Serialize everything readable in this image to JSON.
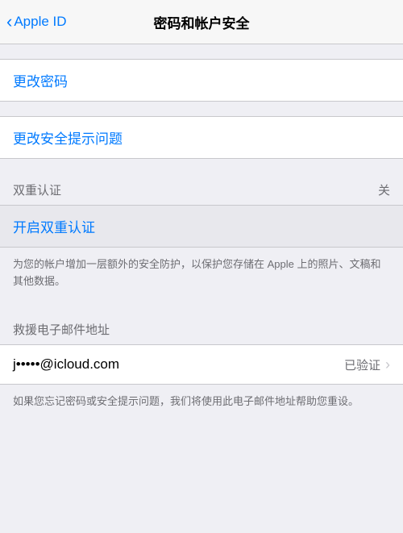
{
  "nav": {
    "back_label": "Apple ID",
    "title": "密码和帐户安全"
  },
  "sections": {
    "change_password": {
      "label": "更改密码"
    },
    "change_security_question": {
      "label": "更改安全提示问题"
    },
    "two_factor": {
      "header_label": "双重认证",
      "header_value": "关",
      "enable_label": "开启双重认证",
      "description": "为您的帐户增加一层额外的安全防护，以保护您存储在 Apple 上的照片、文稿和其他数据。"
    },
    "rescue_email": {
      "header_label": "救援电子邮件地址",
      "email_value": "j•••••@icloud.com",
      "verified_label": "已验证",
      "description": "如果您忘记密码或安全提示问题，我们将使用此电子邮件地址帮助您重设。"
    }
  },
  "icons": {
    "chevron_left": "‹",
    "chevron_right": "›"
  }
}
